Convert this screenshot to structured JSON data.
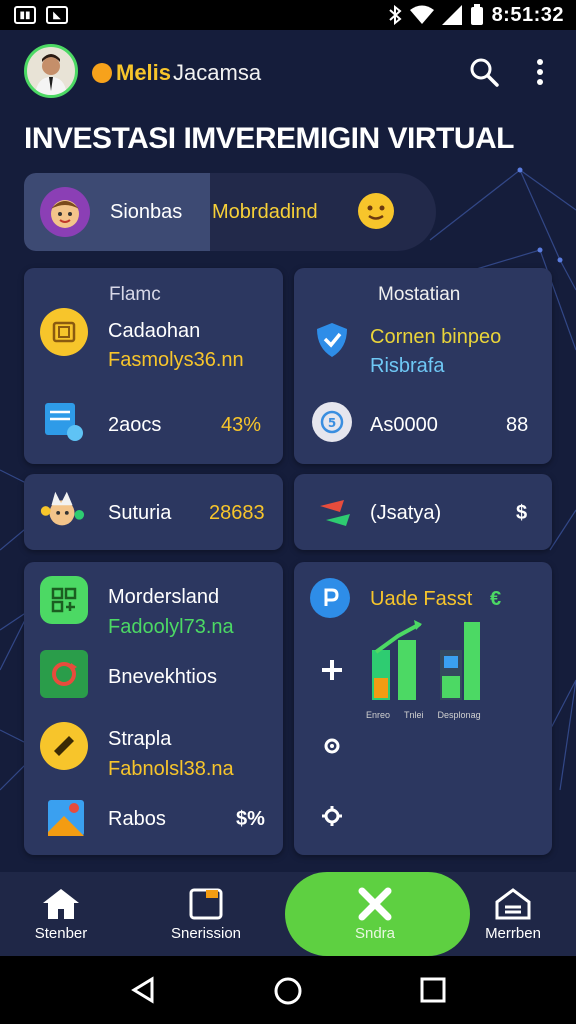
{
  "status_bar": {
    "time": "8:51:32",
    "left_icons": [
      "sim-icon",
      "notification-icon"
    ]
  },
  "header": {
    "brand_prefix": "Melis",
    "brand_suffix": "Jacamsa"
  },
  "page_title": "INVESTASI IMVEREMIGIN VIRTUAL",
  "switch": {
    "option_one": "Sionbas",
    "option_two": "Mobrdadind"
  },
  "card_flame": {
    "title": "Flamc",
    "row1_title": "Cadaohan",
    "row1_subtitle": "Fasmolys36.nn",
    "row2_label": "2aocs",
    "row2_value": "43%"
  },
  "card_mostatian": {
    "title": "Mostatian",
    "row1_title": "Cornen binpeo",
    "row1_subtitle": "Risbrafa",
    "row2_label": "As0000",
    "row2_value": "88"
  },
  "card_suturia": {
    "label": "Suturia",
    "value": "28683"
  },
  "card_osatyd": {
    "label": "(Jsatya)",
    "value": "$"
  },
  "card_list": {
    "item1_title": "Mordersland",
    "item1_subtitle": "Fadoolyl73.na",
    "item2_title": "Bnevekhtios",
    "item3_title": "Strapla",
    "item3_subtitle": "Fabnolsl38.na",
    "item4_title": "Rabos",
    "item4_value": "$%"
  },
  "card_chart": {
    "title": "Uade Fasst",
    "title_symbol": "€",
    "legend": [
      "Enreo",
      "Tnlei",
      "Desplonag"
    ]
  },
  "bottom_nav": [
    {
      "label": "Stenber"
    },
    {
      "label": "Snerission"
    },
    {
      "label": "Sndra"
    },
    {
      "label": "Merrben"
    }
  ],
  "colors": {
    "background": "#151d3b",
    "card": "#2c3760",
    "accent_green": "#5ed041",
    "accent_yellow": "#f7c52b"
  }
}
